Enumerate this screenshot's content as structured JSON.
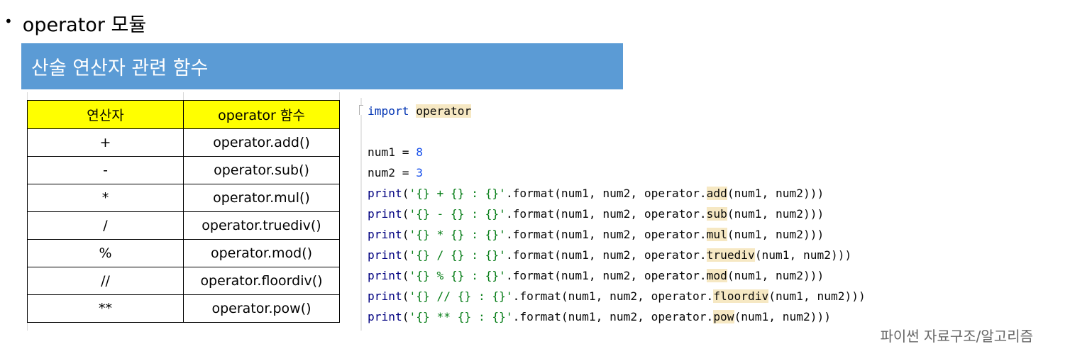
{
  "heading": {
    "bullet": "•",
    "text": "operator 모듈"
  },
  "banner": {
    "title": "산술 연산자 관련 함수"
  },
  "table": {
    "headers": [
      "연산자",
      "operator 함수"
    ],
    "rows": [
      [
        "+",
        "operator.add()"
      ],
      [
        "-",
        "operator.sub()"
      ],
      [
        "*",
        "operator.mul()"
      ],
      [
        "/",
        "operator.truediv()"
      ],
      [
        "%",
        "operator.mod()"
      ],
      [
        "//",
        "operator.floordiv()"
      ],
      [
        "**",
        "operator.pow()"
      ]
    ]
  },
  "code": {
    "import_kw": "import",
    "import_mod": "operator",
    "assign": [
      {
        "name": "num1",
        "op": " = ",
        "value": "8"
      },
      {
        "name": "num2",
        "op": " = ",
        "value": "3"
      }
    ],
    "prints": [
      {
        "kw": "print",
        "open": "(",
        "str": "'{} + {} : {}'",
        "pre": ".format(num1, num2, operator.",
        "func": "add",
        "post": "(num1, num2)))"
      },
      {
        "kw": "print",
        "open": "(",
        "str": "'{} - {} : {}'",
        "pre": ".format(num1, num2, operator.",
        "func": "sub",
        "post": "(num1, num2)))"
      },
      {
        "kw": "print",
        "open": "(",
        "str": "'{} * {} : {}'",
        "pre": ".format(num1, num2, operator.",
        "func": "mul",
        "post": "(num1, num2)))"
      },
      {
        "kw": "print",
        "open": "(",
        "str": "'{} / {} : {}'",
        "pre": ".format(num1, num2, operator.",
        "func": "truediv",
        "post": "(num1, num2)))"
      },
      {
        "kw": "print",
        "open": "(",
        "str": "'{} % {} : {}'",
        "pre": ".format(num1, num2, operator.",
        "func": "mod",
        "post": "(num1, num2)))"
      },
      {
        "kw": "print",
        "open": "(",
        "str": "'{} // {} : {}'",
        "pre": ".format(num1, num2, operator.",
        "func": "floordiv",
        "post": "(num1, num2)))"
      },
      {
        "kw": "print",
        "open": "(",
        "str": "'{} ** {} : {}'",
        "pre": ".format(num1, num2, operator.",
        "func": "pow",
        "post": "(num1, num2)))"
      }
    ]
  },
  "footer": {
    "text": "파이썬 자료구조/알고리즘"
  }
}
